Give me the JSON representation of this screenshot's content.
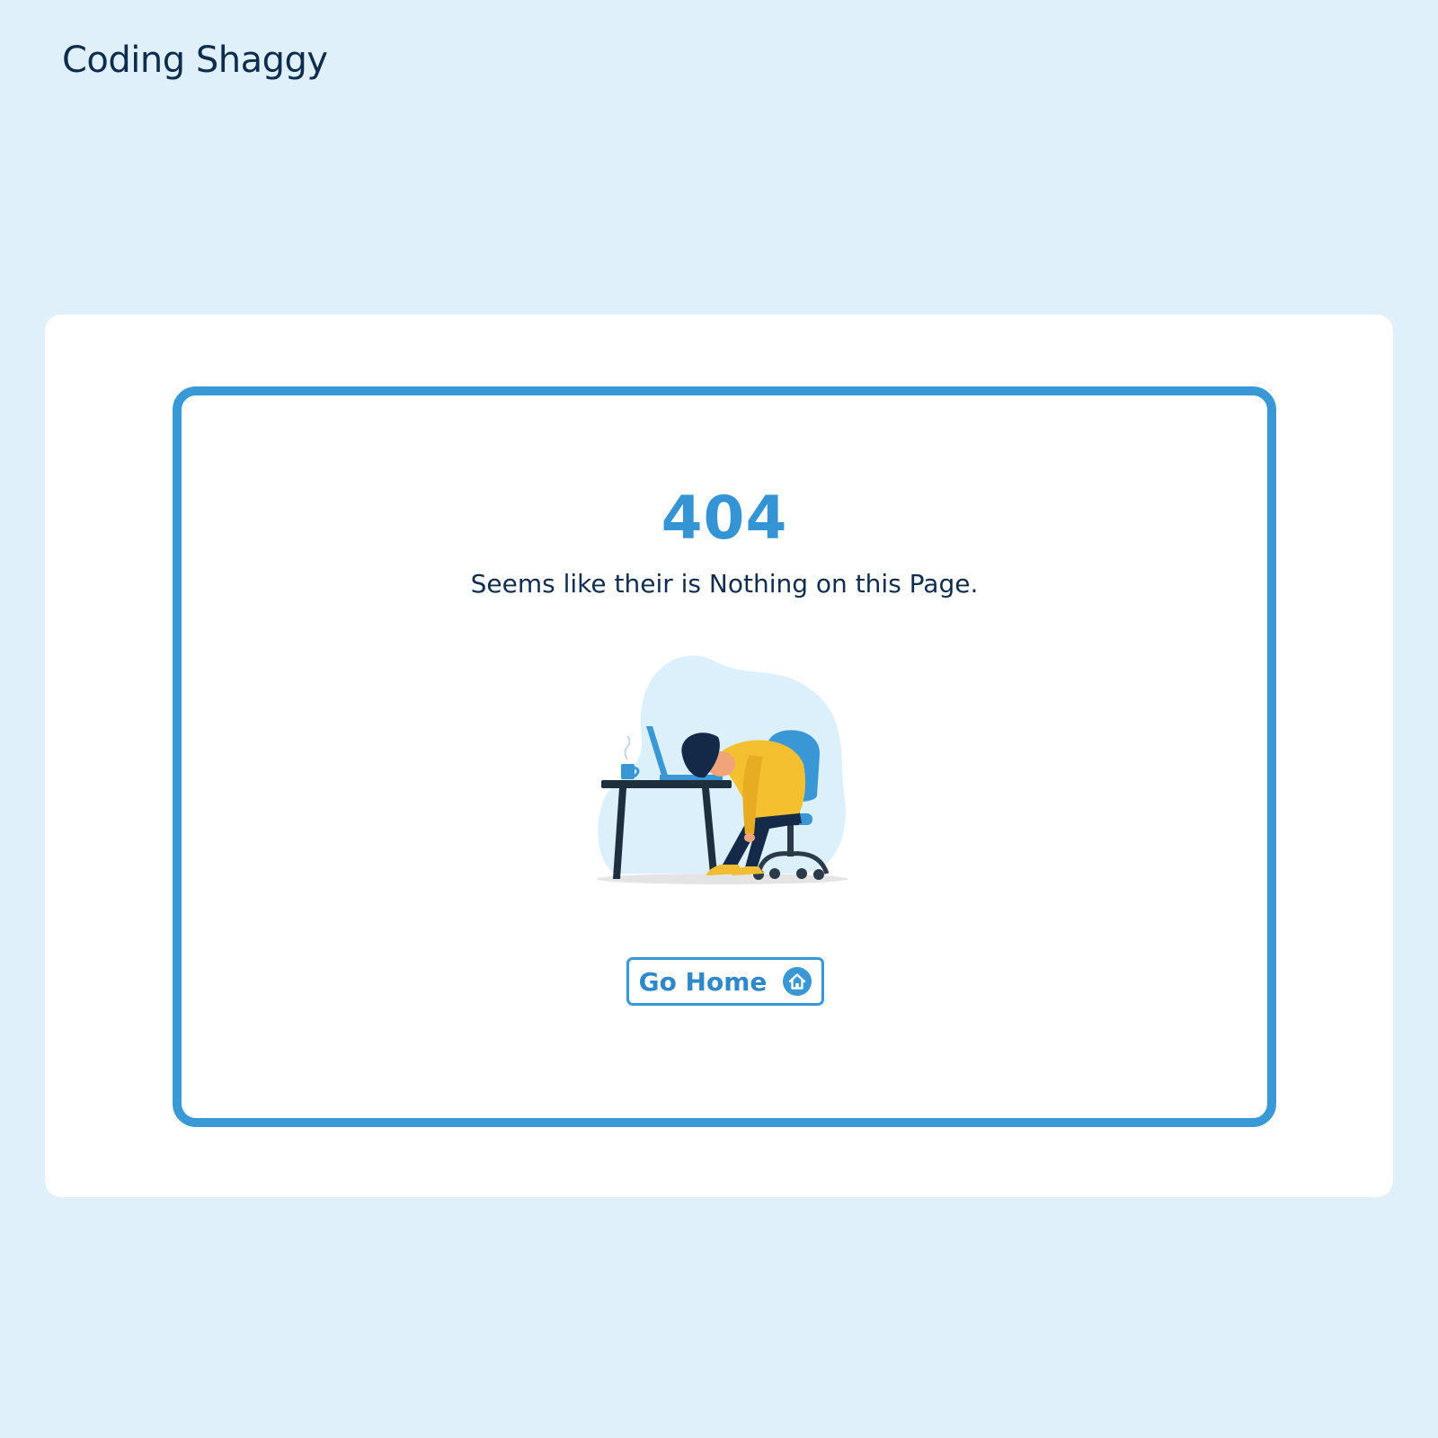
{
  "header": {
    "brand": "Coding Shaggy"
  },
  "error": {
    "code": "404",
    "message": "Seems like their is Nothing on this Page."
  },
  "actions": {
    "go_home_label": "Go Home",
    "go_home_icon": "home-icon"
  },
  "illustration": {
    "subject": "tired-person-at-desk-illustration"
  },
  "colors": {
    "background": "#dff0fa",
    "card": "#ffffff",
    "accent": "#3899d6",
    "text_dark": "#0e2d4e",
    "figure_yellow": "#f4c02f"
  }
}
